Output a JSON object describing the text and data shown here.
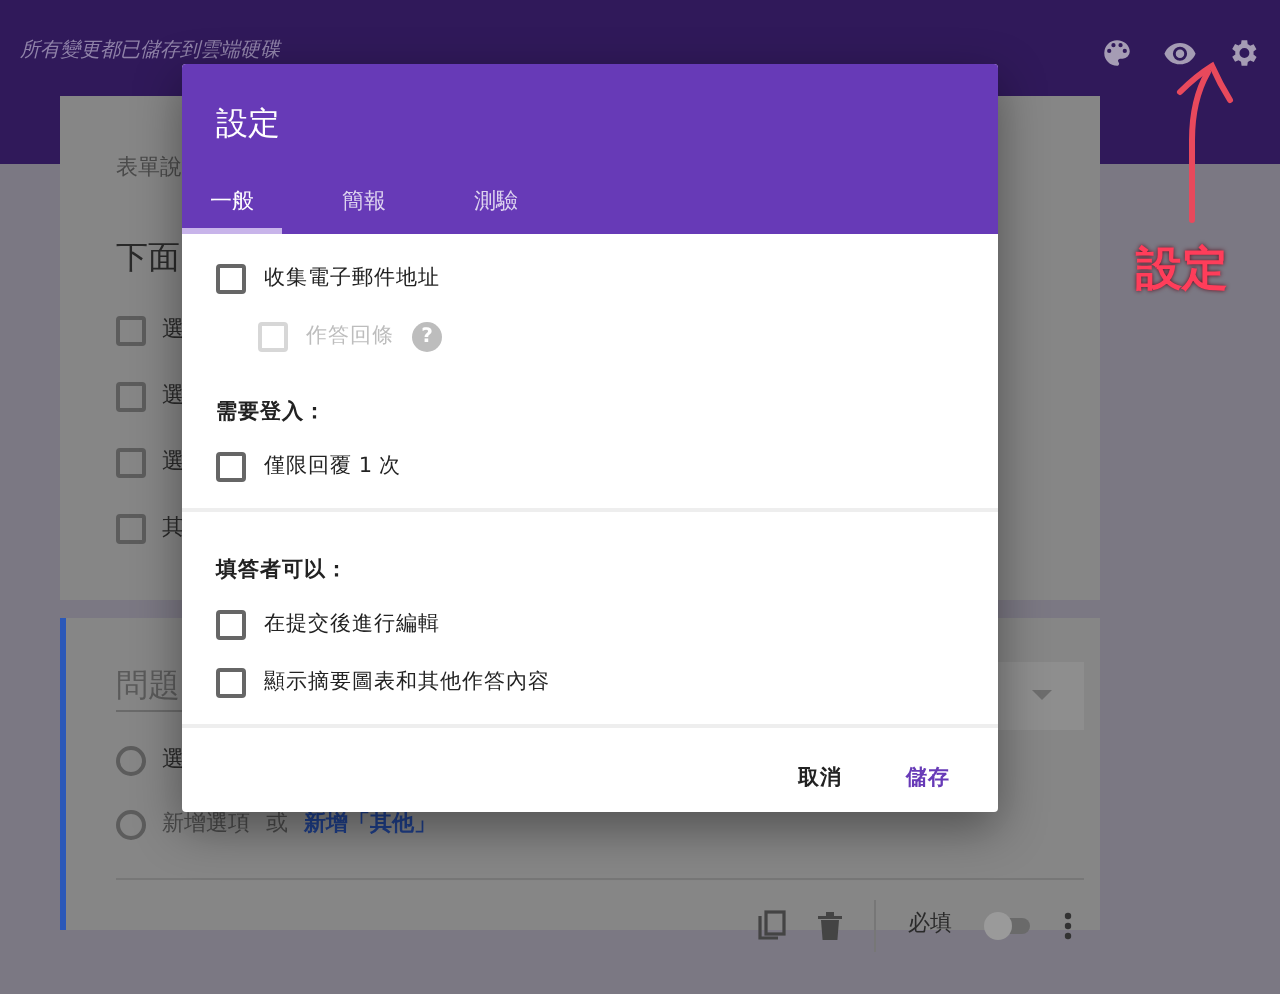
{
  "header": {
    "save_status": "所有變更都已儲存到雲端硬碟"
  },
  "annotation": {
    "text": "設定"
  },
  "form_card": {
    "description": "表單說",
    "question_title": "下面",
    "options": [
      {
        "label": "選",
        "checked": false
      },
      {
        "label": "選",
        "checked": false
      },
      {
        "label": "選",
        "checked": false
      },
      {
        "label": "其",
        "checked": false
      }
    ]
  },
  "question_card": {
    "title_placeholder": "問題",
    "options": [
      {
        "label": "選",
        "selected": false
      }
    ],
    "add_option": "新增選項",
    "add_option_selected": false,
    "or": "或",
    "add_other": "新增「其他」",
    "required_label": "必填",
    "required": false
  },
  "dialog": {
    "title": "設定",
    "tabs": [
      {
        "label": "一般",
        "selected": true
      },
      {
        "label": "簡報",
        "selected": false
      },
      {
        "label": "測驗",
        "selected": false
      }
    ],
    "groups": [
      {
        "sections": [
          {
            "items": [
              {
                "label": "收集電子郵件地址",
                "checked": false,
                "disabled": false,
                "children": [
                  {
                    "label": "作答回條",
                    "checked": false,
                    "disabled": true,
                    "help": "?"
                  }
                ]
              }
            ]
          },
          {
            "heading": "需要登入：",
            "items": [
              {
                "label": "僅限回覆 1 次",
                "checked": false,
                "disabled": false
              }
            ]
          }
        ]
      },
      {
        "sections": [
          {
            "heading": "填答者可以：",
            "items": [
              {
                "label": "在提交後進行編輯",
                "checked": false,
                "disabled": false
              },
              {
                "label": "顯示摘要圖表和其他作答內容",
                "checked": false,
                "disabled": false
              }
            ]
          }
        ]
      }
    ],
    "buttons": [
      {
        "label": "取消",
        "kind": "text"
      },
      {
        "label": "儲存",
        "kind": "primary"
      }
    ]
  }
}
